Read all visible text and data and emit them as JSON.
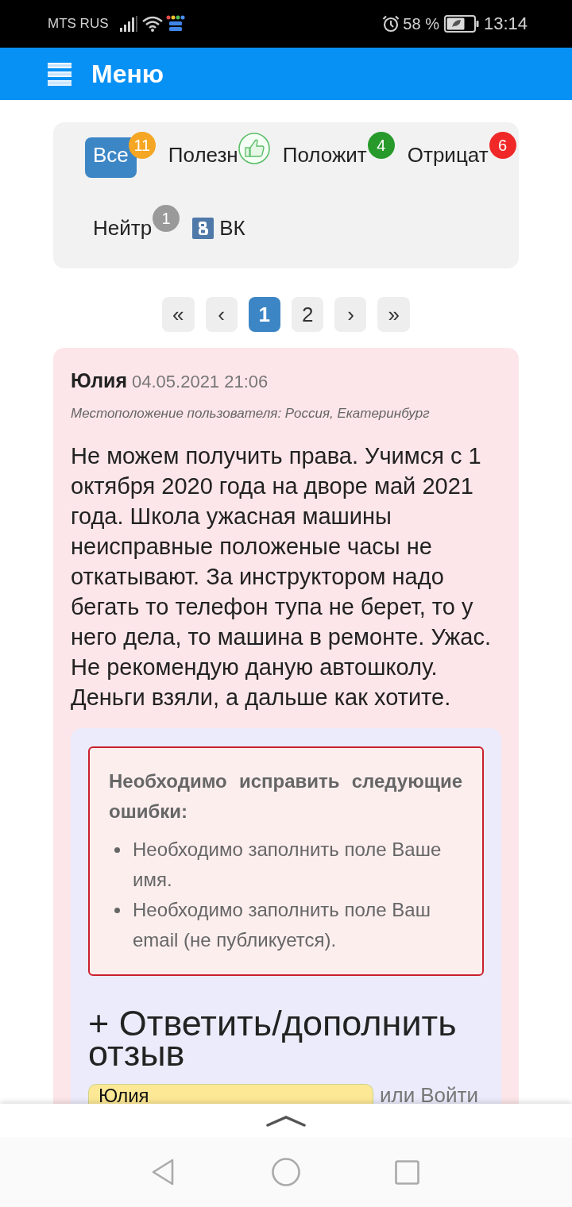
{
  "status_bar": {
    "carrier": "MTS RUS",
    "battery": "58 %",
    "time": "13:14"
  },
  "app_bar": {
    "title": "Меню"
  },
  "filters": [
    {
      "kind": "badge",
      "label": "Все",
      "count": "11",
      "color": "#f5a623",
      "selected": true
    },
    {
      "kind": "icon",
      "label": "Полезн",
      "selected": false
    },
    {
      "kind": "badge",
      "label": "Положит",
      "count": "4",
      "color": "#279a2b",
      "selected": false
    },
    {
      "kind": "badge",
      "label": "Отрицат",
      "count": "6",
      "color": "#f02828",
      "selected": false
    },
    {
      "kind": "badge",
      "label": "Нейтр",
      "count": "1",
      "color": "#9a9a9a",
      "selected": false
    },
    {
      "kind": "vk",
      "label": "ВК",
      "selected": false
    }
  ],
  "pagination": [
    {
      "label": "«",
      "selected": false
    },
    {
      "label": "‹",
      "selected": false
    },
    {
      "label": "1",
      "selected": true
    },
    {
      "label": "2",
      "selected": false
    },
    {
      "label": "›",
      "selected": false
    },
    {
      "label": "»",
      "selected": false
    }
  ],
  "review": {
    "author": "Юлия",
    "date": "04.05.2021 21:06",
    "location": "Местоположение пользователя: Россия, Екатеринбург",
    "text": "Не можем получить права. Учимся с 1 октября 2020 года на дворе май 2021 года. Школа ужасная машины неисправные положеные часы не откатывают. За инструктором надо бегать то телефон тупа не берет, то у него дела, то машина в ремонте. Ужас. Не рекомендую даную автошколу. Деньги взяли, а дальше как хотите."
  },
  "reply_form": {
    "errors": {
      "title": "Необходимо исправить следующие ошибки:",
      "items": [
        "Необходимо заполнить поле Ваше имя.",
        "Необходимо заполнить поле Ваш email (не публикуется)."
      ]
    },
    "title": "+ Ответить/дополнить отзыв",
    "name_field": {
      "value": "Юлия"
    },
    "or_text": "или",
    "login_link": "Войти"
  }
}
